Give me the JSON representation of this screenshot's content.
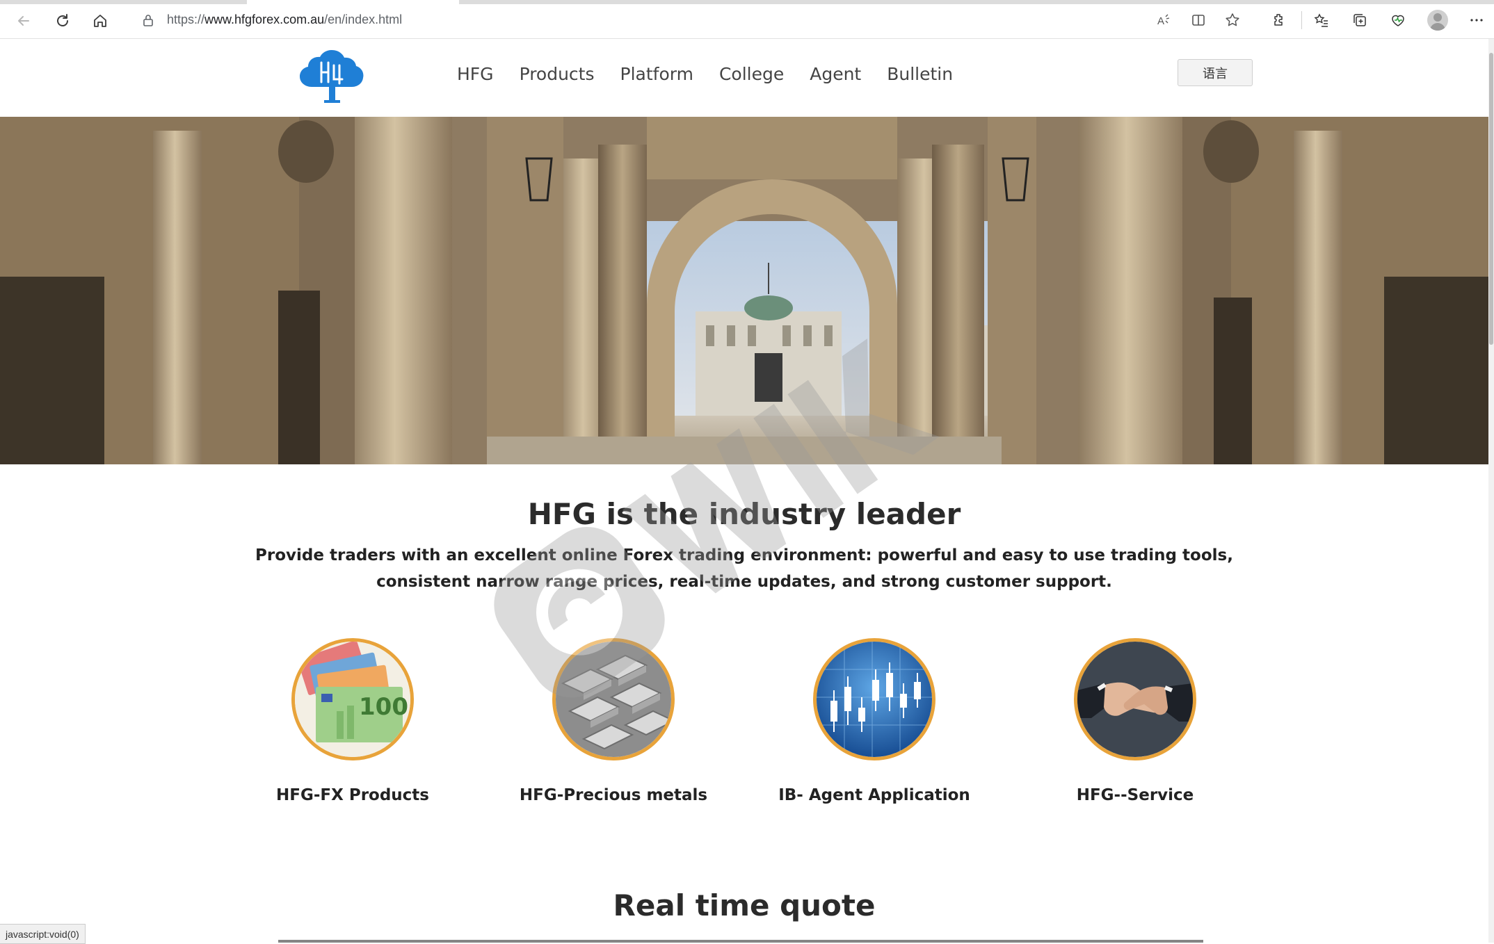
{
  "browser": {
    "url_scheme": "https://",
    "url_host": "www.hfgforex.com.au",
    "url_path": "/en/index.html",
    "status_text": "javascript:void(0)"
  },
  "header": {
    "nav": [
      "HFG",
      "Products",
      "Platform",
      "College",
      "Agent",
      "Bulletin"
    ],
    "language_button": "语言"
  },
  "intro": {
    "title": "HFG is the industry leader",
    "subtitle": "Provide traders with an excellent online Forex trading environment: powerful and easy to use trading tools, consistent narrow range prices, real-time updates, and strong customer support."
  },
  "features": [
    {
      "label": "HFG-FX Products",
      "icon": "banknotes-image"
    },
    {
      "label": "HFG-Precious metals",
      "icon": "silver-bars-image"
    },
    {
      "label": "IB- Agent Application",
      "icon": "candlestick-chart-image"
    },
    {
      "label": "HFG--Service",
      "icon": "handshake-image"
    }
  ],
  "quote_section": {
    "title": "Real time quote"
  },
  "colors": {
    "accent_ring": "#e8a33a",
    "logo_blue": "#1f7fd6",
    "text_dark": "#2b2b2b"
  }
}
